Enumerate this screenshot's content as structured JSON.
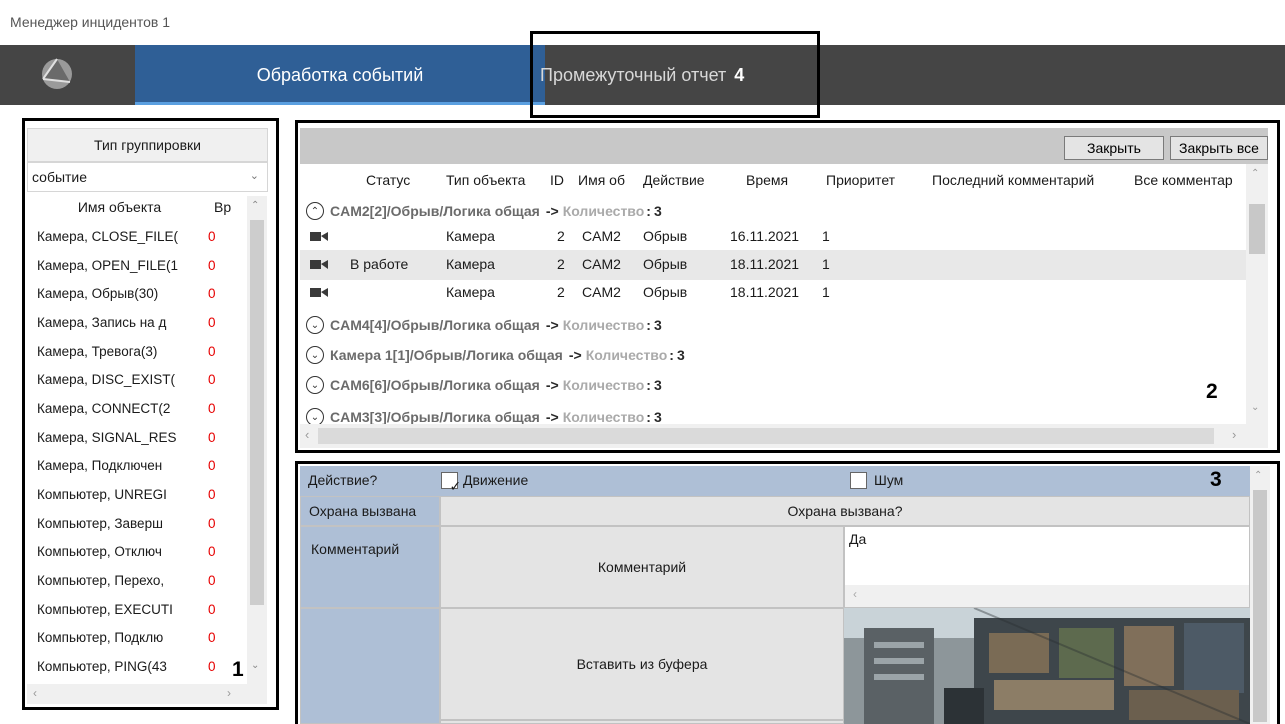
{
  "window": {
    "title": "Менеджер инцидентов 1"
  },
  "nav": {
    "tabs": [
      {
        "label": "Обработка событий"
      },
      {
        "label": "Промежуточный отчет"
      }
    ]
  },
  "annotations": {
    "n1": "1",
    "n2": "2",
    "n3": "3",
    "n4": "4"
  },
  "left": {
    "grouping_header": "Тип группировки",
    "grouping_value": "событие",
    "col_name": "Имя объекта",
    "col_time": "Вр",
    "rows": [
      {
        "name": "Камера, CLOSE_FILE(",
        "count": "0"
      },
      {
        "name": "Камера, OPEN_FILE(1",
        "count": "0"
      },
      {
        "name": "Камера, Обрыв(30)",
        "count": "0"
      },
      {
        "name": "Камера, Запись на д",
        "count": "0"
      },
      {
        "name": "Камера, Тревога(3)",
        "count": "0"
      },
      {
        "name": "Камера, DISC_EXIST(",
        "count": "0"
      },
      {
        "name": "Камера, CONNECT(2",
        "count": "0"
      },
      {
        "name": "Камера, SIGNAL_RES",
        "count": "0"
      },
      {
        "name": "Камера, Подключен",
        "count": "0"
      },
      {
        "name": "Компьютер, UNREGI",
        "count": "0"
      },
      {
        "name": "Компьютер, Заверш",
        "count": "0"
      },
      {
        "name": "Компьютер, Отключ",
        "count": "0"
      },
      {
        "name": "Компьютер, Перехо,",
        "count": "0"
      },
      {
        "name": "Компьютер, EXECUTI",
        "count": "0"
      },
      {
        "name": "Компьютер, Подклю",
        "count": "0"
      },
      {
        "name": "Компьютер, PING(43",
        "count": "0"
      }
    ]
  },
  "events": {
    "close_label": "Закрыть",
    "close_all_label": "Закрыть все",
    "columns": {
      "status": "Статус",
      "type": "Тип объекта",
      "id": "ID",
      "name": "Имя об",
      "action": "Действие",
      "time": "Время",
      "priority": "Приоритет",
      "last_comment": "Последний комментарий",
      "all_comments": "Все комментар"
    },
    "count_label": "Количество",
    "arrow": "->",
    "groups": [
      {
        "name": "CAM2[2]/Обрыв/Логика общая",
        "count": "3",
        "expanded": true
      },
      {
        "name": "CAM4[4]/Обрыв/Логика общая",
        "count": "3"
      },
      {
        "name": "Камера 1[1]/Обрыв/Логика общая",
        "count": "3"
      },
      {
        "name": "CAM6[6]/Обрыв/Логика общая",
        "count": "3"
      },
      {
        "name": "CAM3[3]/Обрыв/Логика общая",
        "count": "3"
      }
    ],
    "rows": [
      {
        "status": "",
        "type": "Камера",
        "id": "2",
        "name": "CAM2",
        "action": "Обрыв",
        "time": "16.11.2021",
        "priority": "1"
      },
      {
        "status": "В работе",
        "type": "Камера",
        "id": "2",
        "name": "CAM2",
        "action": "Обрыв",
        "time": "18.11.2021",
        "priority": "1"
      },
      {
        "status": "",
        "type": "Камера",
        "id": "2",
        "name": "CAM2",
        "action": "Обрыв",
        "time": "18.11.2021",
        "priority": "1"
      }
    ]
  },
  "form": {
    "action_label": "Действие?",
    "movement_label": "Движение",
    "movement_checked": "✓",
    "noise_label": "Шум",
    "guard_label": "Охрана вызвана",
    "guard_button": "Охрана вызвана?",
    "comment_label": "Комментарий",
    "comment_button": "Комментарий",
    "comment_value": "Да",
    "paste_button": "Вставить из буфера"
  }
}
